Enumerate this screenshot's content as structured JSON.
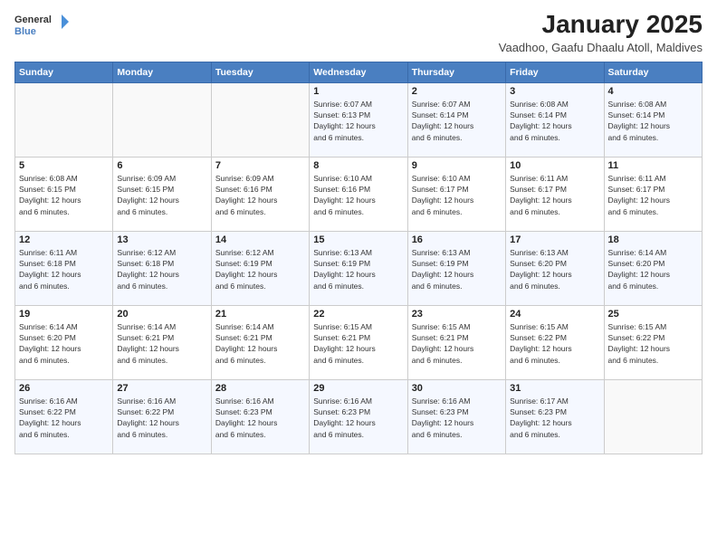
{
  "header": {
    "logo_line1": "General",
    "logo_line2": "Blue",
    "title": "January 2025",
    "subtitle": "Vaadhoo, Gaafu Dhaalu Atoll, Maldives"
  },
  "days_of_week": [
    "Sunday",
    "Monday",
    "Tuesday",
    "Wednesday",
    "Thursday",
    "Friday",
    "Saturday"
  ],
  "weeks": [
    [
      {
        "day": "",
        "info": ""
      },
      {
        "day": "",
        "info": ""
      },
      {
        "day": "",
        "info": ""
      },
      {
        "day": "1",
        "info": "Sunrise: 6:07 AM\nSunset: 6:13 PM\nDaylight: 12 hours\nand 6 minutes."
      },
      {
        "day": "2",
        "info": "Sunrise: 6:07 AM\nSunset: 6:14 PM\nDaylight: 12 hours\nand 6 minutes."
      },
      {
        "day": "3",
        "info": "Sunrise: 6:08 AM\nSunset: 6:14 PM\nDaylight: 12 hours\nand 6 minutes."
      },
      {
        "day": "4",
        "info": "Sunrise: 6:08 AM\nSunset: 6:14 PM\nDaylight: 12 hours\nand 6 minutes."
      }
    ],
    [
      {
        "day": "5",
        "info": "Sunrise: 6:08 AM\nSunset: 6:15 PM\nDaylight: 12 hours\nand 6 minutes."
      },
      {
        "day": "6",
        "info": "Sunrise: 6:09 AM\nSunset: 6:15 PM\nDaylight: 12 hours\nand 6 minutes."
      },
      {
        "day": "7",
        "info": "Sunrise: 6:09 AM\nSunset: 6:16 PM\nDaylight: 12 hours\nand 6 minutes."
      },
      {
        "day": "8",
        "info": "Sunrise: 6:10 AM\nSunset: 6:16 PM\nDaylight: 12 hours\nand 6 minutes."
      },
      {
        "day": "9",
        "info": "Sunrise: 6:10 AM\nSunset: 6:17 PM\nDaylight: 12 hours\nand 6 minutes."
      },
      {
        "day": "10",
        "info": "Sunrise: 6:11 AM\nSunset: 6:17 PM\nDaylight: 12 hours\nand 6 minutes."
      },
      {
        "day": "11",
        "info": "Sunrise: 6:11 AM\nSunset: 6:17 PM\nDaylight: 12 hours\nand 6 minutes."
      }
    ],
    [
      {
        "day": "12",
        "info": "Sunrise: 6:11 AM\nSunset: 6:18 PM\nDaylight: 12 hours\nand 6 minutes."
      },
      {
        "day": "13",
        "info": "Sunrise: 6:12 AM\nSunset: 6:18 PM\nDaylight: 12 hours\nand 6 minutes."
      },
      {
        "day": "14",
        "info": "Sunrise: 6:12 AM\nSunset: 6:19 PM\nDaylight: 12 hours\nand 6 minutes."
      },
      {
        "day": "15",
        "info": "Sunrise: 6:13 AM\nSunset: 6:19 PM\nDaylight: 12 hours\nand 6 minutes."
      },
      {
        "day": "16",
        "info": "Sunrise: 6:13 AM\nSunset: 6:19 PM\nDaylight: 12 hours\nand 6 minutes."
      },
      {
        "day": "17",
        "info": "Sunrise: 6:13 AM\nSunset: 6:20 PM\nDaylight: 12 hours\nand 6 minutes."
      },
      {
        "day": "18",
        "info": "Sunrise: 6:14 AM\nSunset: 6:20 PM\nDaylight: 12 hours\nand 6 minutes."
      }
    ],
    [
      {
        "day": "19",
        "info": "Sunrise: 6:14 AM\nSunset: 6:20 PM\nDaylight: 12 hours\nand 6 minutes."
      },
      {
        "day": "20",
        "info": "Sunrise: 6:14 AM\nSunset: 6:21 PM\nDaylight: 12 hours\nand 6 minutes."
      },
      {
        "day": "21",
        "info": "Sunrise: 6:14 AM\nSunset: 6:21 PM\nDaylight: 12 hours\nand 6 minutes."
      },
      {
        "day": "22",
        "info": "Sunrise: 6:15 AM\nSunset: 6:21 PM\nDaylight: 12 hours\nand 6 minutes."
      },
      {
        "day": "23",
        "info": "Sunrise: 6:15 AM\nSunset: 6:21 PM\nDaylight: 12 hours\nand 6 minutes."
      },
      {
        "day": "24",
        "info": "Sunrise: 6:15 AM\nSunset: 6:22 PM\nDaylight: 12 hours\nand 6 minutes."
      },
      {
        "day": "25",
        "info": "Sunrise: 6:15 AM\nSunset: 6:22 PM\nDaylight: 12 hours\nand 6 minutes."
      }
    ],
    [
      {
        "day": "26",
        "info": "Sunrise: 6:16 AM\nSunset: 6:22 PM\nDaylight: 12 hours\nand 6 minutes."
      },
      {
        "day": "27",
        "info": "Sunrise: 6:16 AM\nSunset: 6:22 PM\nDaylight: 12 hours\nand 6 minutes."
      },
      {
        "day": "28",
        "info": "Sunrise: 6:16 AM\nSunset: 6:23 PM\nDaylight: 12 hours\nand 6 minutes."
      },
      {
        "day": "29",
        "info": "Sunrise: 6:16 AM\nSunset: 6:23 PM\nDaylight: 12 hours\nand 6 minutes."
      },
      {
        "day": "30",
        "info": "Sunrise: 6:16 AM\nSunset: 6:23 PM\nDaylight: 12 hours\nand 6 minutes."
      },
      {
        "day": "31",
        "info": "Sunrise: 6:17 AM\nSunset: 6:23 PM\nDaylight: 12 hours\nand 6 minutes."
      },
      {
        "day": "",
        "info": ""
      }
    ]
  ]
}
